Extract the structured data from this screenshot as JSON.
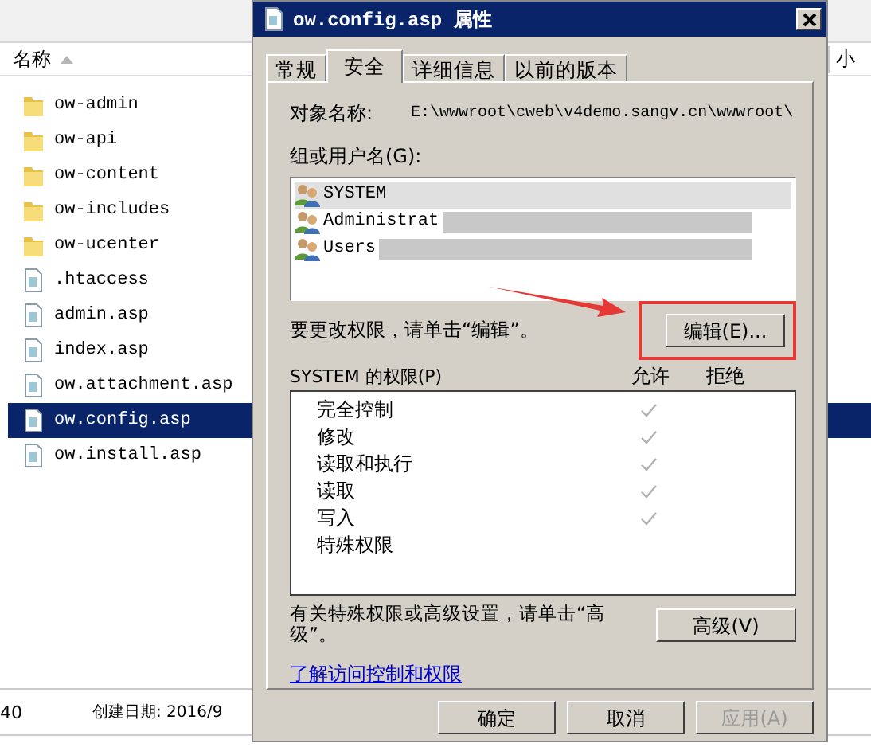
{
  "explorer": {
    "column_header": "名称",
    "column_2": "小",
    "files": [
      {
        "name": "ow-admin",
        "kind": "folder",
        "selected": false
      },
      {
        "name": "ow-api",
        "kind": "folder",
        "selected": false
      },
      {
        "name": "ow-content",
        "kind": "folder",
        "selected": false
      },
      {
        "name": "ow-includes",
        "kind": "folder",
        "selected": false
      },
      {
        "name": "ow-ucenter",
        "kind": "folder",
        "selected": false
      },
      {
        "name": ".htaccess",
        "kind": "file",
        "selected": false
      },
      {
        "name": "admin.asp",
        "kind": "file",
        "selected": false
      },
      {
        "name": "index.asp",
        "kind": "file",
        "selected": false
      },
      {
        "name": "ow.attachment.asp",
        "kind": "file",
        "selected": false
      },
      {
        "name": "ow.config.asp",
        "kind": "file",
        "selected": true
      },
      {
        "name": "ow.install.asp",
        "kind": "file",
        "selected": false
      }
    ],
    "status_bar": {
      "size": "40",
      "created": "创建日期: 2016/9"
    }
  },
  "dialog": {
    "title": "ow.config.asp 属性",
    "tabs": [
      {
        "label": "常规",
        "selected": false
      },
      {
        "label": "安全",
        "selected": true
      },
      {
        "label": "详细信息",
        "selected": false
      },
      {
        "label": "以前的版本",
        "selected": false
      }
    ],
    "object_label": "对象名称:",
    "object_value": "E:\\wwwroot\\cweb\\v4demo.sangv.cn\\wwwroot\\",
    "users_label": "组或用户名(G):",
    "users": [
      {
        "name": "SYSTEM",
        "selected": true,
        "redacted": false
      },
      {
        "name": "Administrat",
        "selected": false,
        "redacted": true
      },
      {
        "name": "Users",
        "selected": false,
        "redacted": true
      }
    ],
    "edit_hint": "要更改权限，请单击“编辑”。",
    "edit_button": "编辑(E)...",
    "permissions_label": "SYSTEM 的权限(P)",
    "allow_header": "允许",
    "deny_header": "拒绝",
    "permissions": [
      {
        "name": "完全控制",
        "allow": true,
        "deny": false
      },
      {
        "name": "修改",
        "allow": true,
        "deny": false
      },
      {
        "name": "读取和执行",
        "allow": true,
        "deny": false
      },
      {
        "name": "读取",
        "allow": true,
        "deny": false
      },
      {
        "name": "写入",
        "allow": true,
        "deny": false
      },
      {
        "name": "特殊权限",
        "allow": false,
        "deny": false
      }
    ],
    "advanced_hint": "有关特殊权限或高级设置，请单击“高级”。",
    "advanced_button": "高级(V)",
    "link": "了解访问控制和权限",
    "buttons": [
      {
        "label": "确定",
        "disabled": false
      },
      {
        "label": "取消",
        "disabled": false
      },
      {
        "label": "应用(A)",
        "disabled": true
      }
    ]
  }
}
